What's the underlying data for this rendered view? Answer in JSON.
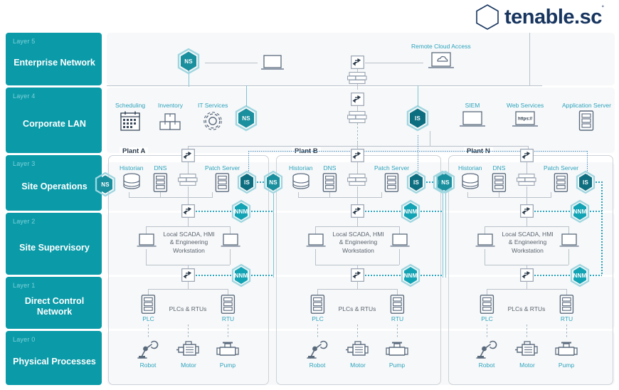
{
  "brand": {
    "name": "tenable.sc",
    "trademark": "˚",
    "logo_icon": "hexagon-outline-icon",
    "logo_color": "#17355f"
  },
  "colors": {
    "layer_card": "#0a9aa8",
    "layer_sub_text": "#7fd2da",
    "hex_ns": "#1a8f9e",
    "hex_is": "#0d6e80",
    "hex_nnm": "#12a3b4",
    "label_teal": "#2ba3bd",
    "band": "#f7f8f9",
    "line": "#b9c2cb",
    "icon_outline": "#5a6a7d"
  },
  "layers": [
    {
      "sub": "Layer 5",
      "title": "Enterprise Network"
    },
    {
      "sub": "Layer 4",
      "title": "Corporate LAN"
    },
    {
      "sub": "Layer 3",
      "title": "Site Operations"
    },
    {
      "sub": "Layer 2",
      "title": "Site Supervisory"
    },
    {
      "sub": "Layer 1",
      "title": "Direct Control Network"
    },
    {
      "sub": "Layer 0",
      "title": "Physical Processes"
    }
  ],
  "enterprise": {
    "sensor": "NS",
    "workstation_icon": "laptop-icon",
    "router_icon": "router-icon",
    "firewall_icon": "firewall-icon",
    "cloud_label": "Remote Cloud Access",
    "cloud_icon": "cloud-laptop-icon"
  },
  "corporate": {
    "left_nodes": [
      {
        "label": "Scheduling",
        "icon": "calendar-icon"
      },
      {
        "label": "Inventory",
        "icon": "boxes-icon"
      },
      {
        "label": "IT Services",
        "icon": "gear-icon"
      }
    ],
    "right_nodes": [
      {
        "label": "SIEM",
        "icon": "laptop-icon"
      },
      {
        "label": "Web Services",
        "icon": "laptop-https-icon",
        "screen_text": "https://"
      },
      {
        "label": "Application Server",
        "icon": "server-rack-icon"
      }
    ],
    "sensor": "NS",
    "scanner": "IS",
    "router_icon": "router-icon",
    "firewall_icon": "firewall-icon"
  },
  "plants": [
    {
      "name": "Plant A",
      "site_ops": [
        {
          "label": "Historian",
          "icon": "database-icon"
        },
        {
          "label": "DNS",
          "icon": "server-rack-icon"
        },
        {
          "label": "",
          "icon": "firewall-icon"
        },
        {
          "label": "Patch Server",
          "icon": "server-rack-icon"
        }
      ],
      "hex_is": "IS",
      "hex_ns": "NS",
      "hex_nnm_l3": "NNM",
      "hex_nnm_l2": "NNM",
      "supervisory_caption": "Local SCADA, HMI & Engineering Workstation",
      "supervisory_icons": [
        "laptop-icon",
        "laptop-icon"
      ],
      "control_caption": "PLCs & RTUs",
      "control_nodes": [
        {
          "label": "PLC",
          "icon": "server-rack-icon"
        },
        {
          "label": "RTU",
          "icon": "server-rack-icon"
        }
      ],
      "physical_nodes": [
        {
          "label": "Robot",
          "icon": "robot-arm-icon"
        },
        {
          "label": "Motor",
          "icon": "motor-icon"
        },
        {
          "label": "Pump",
          "icon": "pump-icon"
        }
      ]
    },
    {
      "name": "Plant B",
      "site_ops": [
        {
          "label": "Historian",
          "icon": "database-icon"
        },
        {
          "label": "DNS",
          "icon": "server-rack-icon"
        },
        {
          "label": "",
          "icon": "firewall-icon"
        },
        {
          "label": "Patch Server",
          "icon": "server-rack-icon"
        }
      ],
      "hex_is": "IS",
      "hex_ns": "NS",
      "hex_nnm_l3": "NNM",
      "hex_nnm_l2": "NNM",
      "supervisory_caption": "Local SCADA, HMI & Engineering Workstation",
      "supervisory_icons": [
        "laptop-icon",
        "laptop-icon"
      ],
      "control_caption": "PLCs & RTUs",
      "control_nodes": [
        {
          "label": "PLC",
          "icon": "server-rack-icon"
        },
        {
          "label": "RTU",
          "icon": "server-rack-icon"
        }
      ],
      "physical_nodes": [
        {
          "label": "Robot",
          "icon": "robot-arm-icon"
        },
        {
          "label": "Motor",
          "icon": "motor-icon"
        },
        {
          "label": "Pump",
          "icon": "pump-icon"
        }
      ]
    },
    {
      "name": "Plant N",
      "site_ops": [
        {
          "label": "Historian",
          "icon": "database-icon"
        },
        {
          "label": "DNS",
          "icon": "server-rack-icon"
        },
        {
          "label": "",
          "icon": "firewall-icon"
        },
        {
          "label": "Patch Server",
          "icon": "server-rack-icon"
        }
      ],
      "hex_is": "IS",
      "hex_ns": "NS",
      "hex_nnm_l3": "NNM",
      "hex_nnm_l2": "NNM",
      "supervisory_caption": "Local SCADA, HMI & Engineering Workstation",
      "supervisory_icons": [
        "laptop-icon",
        "laptop-icon"
      ],
      "control_caption": "PLCs & RTUs",
      "control_nodes": [
        {
          "label": "PLC",
          "icon": "server-rack-icon"
        },
        {
          "label": "RTU",
          "icon": "server-rack-icon"
        }
      ],
      "physical_nodes": [
        {
          "label": "Robot",
          "icon": "robot-arm-icon"
        },
        {
          "label": "Motor",
          "icon": "motor-icon"
        },
        {
          "label": "Pump",
          "icon": "pump-icon"
        }
      ]
    }
  ],
  "standalone_sensor": {
    "label": "NS"
  }
}
